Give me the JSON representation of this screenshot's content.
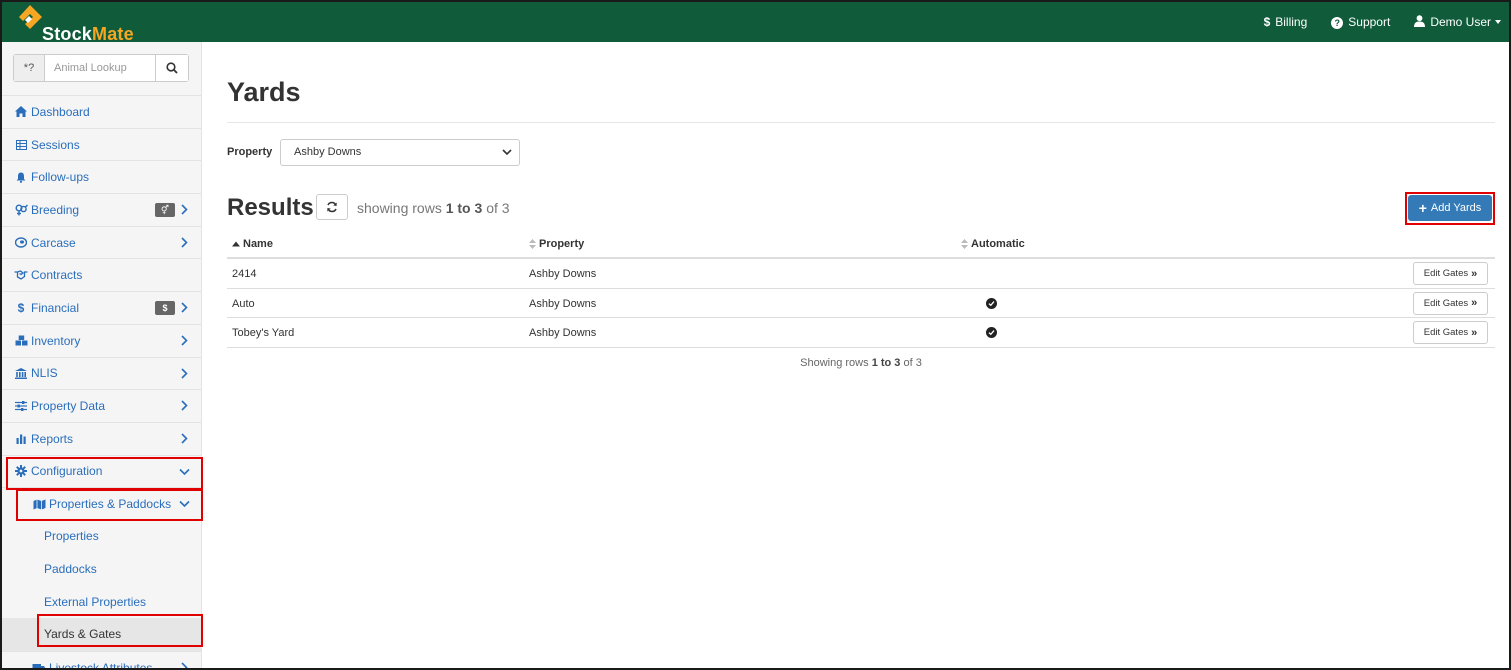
{
  "app": {
    "logo_text_1": "Stock",
    "logo_text_2": "Mate"
  },
  "topnav": {
    "billing": "Billing",
    "support": "Support",
    "user": "Demo User"
  },
  "sidebar": {
    "search_prefix": "*?",
    "search_placeholder": "Animal Lookup",
    "items": [
      {
        "label": "Dashboard",
        "icon": "home-icon"
      },
      {
        "label": "Sessions",
        "icon": "table-icon"
      },
      {
        "label": "Follow-ups",
        "icon": "bell-icon"
      },
      {
        "label": "Breeding",
        "icon": "venus-mars-icon",
        "badge": "⚥",
        "chevron": true
      },
      {
        "label": "Carcase",
        "icon": "carcase-icon",
        "chevron": true
      },
      {
        "label": "Contracts",
        "icon": "handshake-icon"
      },
      {
        "label": "Financial",
        "icon": "dollar-icon",
        "badge": "$",
        "chevron": true
      },
      {
        "label": "Inventory",
        "icon": "boxes-icon",
        "chevron": true
      },
      {
        "label": "NLIS",
        "icon": "bank-icon",
        "chevron": true
      },
      {
        "label": "Property Data",
        "icon": "sliders-icon",
        "chevron": true
      },
      {
        "label": "Reports",
        "icon": "bar-chart-icon",
        "chevron": true
      },
      {
        "label": "Configuration",
        "icon": "gear-icon",
        "expanded": true
      },
      {
        "label": "Properties & Paddocks",
        "icon": "map-icon",
        "expanded": true
      },
      {
        "label": "Properties"
      },
      {
        "label": "Paddocks"
      },
      {
        "label": "External Properties"
      },
      {
        "label": "Yards & Gates",
        "active": true
      },
      {
        "label": "Livestock Attributes",
        "icon": "truck-icon",
        "chevron": true
      }
    ]
  },
  "main": {
    "title": "Yards",
    "property_label": "Property",
    "property_value": "Ashby Downs",
    "results_title": "Results",
    "showing_prefix": "showing rows",
    "showing_range": "1 to 3",
    "showing_of": "of 3",
    "add_button": "Add Yards",
    "columns": [
      "Name",
      "Property",
      "Automatic"
    ],
    "rows": [
      {
        "name": "2414",
        "property": "Ashby Downs",
        "automatic": false,
        "action": "Edit Gates"
      },
      {
        "name": "Auto",
        "property": "Ashby Downs",
        "automatic": true,
        "action": "Edit Gates"
      },
      {
        "name": "Tobey's Yard",
        "property": "Ashby Downs",
        "automatic": true,
        "action": "Edit Gates"
      }
    ],
    "footer_prefix": "Showing rows",
    "footer_range": "1 to 3",
    "footer_of": "of 3"
  },
  "colors": {
    "topbar": "#0f5b3a",
    "brand_accent": "#f5a623",
    "link": "#2a6ebb",
    "primary_button": "#337ab7",
    "highlight": "#e00000"
  }
}
